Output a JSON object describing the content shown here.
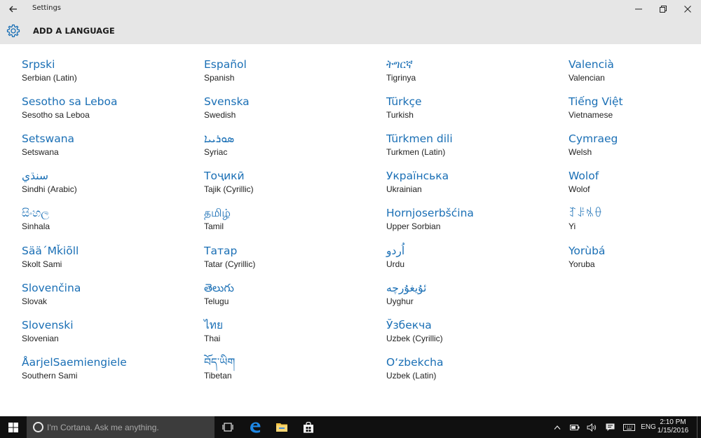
{
  "window": {
    "title": "Settings",
    "back_icon": "back-arrow-icon",
    "minimize_glyph": "—",
    "maximize_glyph": "❐",
    "close_glyph": "✕"
  },
  "header": {
    "icon": "gear-icon",
    "heading": "ADD A LANGUAGE"
  },
  "languages": [
    {
      "native": "Srpski",
      "english": "Serbian (Latin)"
    },
    {
      "native": "Sesotho sa Leboa",
      "english": "Sesotho sa Leboa"
    },
    {
      "native": "Setswana",
      "english": "Setswana"
    },
    {
      "native": "سنڌي",
      "english": "Sindhi (Arabic)"
    },
    {
      "native": "සිංහල",
      "english": "Sinhala"
    },
    {
      "native": "Sää´Mǩiõll",
      "english": "Skolt Sami"
    },
    {
      "native": "Slovenčina",
      "english": "Slovak"
    },
    {
      "native": "Slovenski",
      "english": "Slovenian"
    },
    {
      "native": "ÅarjelSaemiengiele",
      "english": "Southern Sami"
    },
    {
      "native": "Español",
      "english": "Spanish"
    },
    {
      "native": "Svenska",
      "english": "Swedish"
    },
    {
      "native": "ܣܘܪܝܝܐ",
      "english": "Syriac"
    },
    {
      "native": "Тоҷикӣ",
      "english": "Tajik (Cyrillic)"
    },
    {
      "native": "தமிழ்",
      "english": "Tamil"
    },
    {
      "native": "Татар",
      "english": "Tatar (Cyrillic)"
    },
    {
      "native": "తెలుగు",
      "english": "Telugu"
    },
    {
      "native": "ไทย",
      "english": "Thai"
    },
    {
      "native": "བོད་ཡིག",
      "english": "Tibetan"
    },
    {
      "native": "ትግርኛ",
      "english": "Tigrinya"
    },
    {
      "native": "Türkçe",
      "english": "Turkish"
    },
    {
      "native": "Türkmen dili",
      "english": "Turkmen (Latin)"
    },
    {
      "native": "Українська",
      "english": "Ukrainian"
    },
    {
      "native": "Hornjoserbšćina",
      "english": "Upper Sorbian"
    },
    {
      "native": "اُردو",
      "english": "Urdu"
    },
    {
      "native": "ئۇيغۇرچە",
      "english": "Uyghur"
    },
    {
      "native": "Ўзбекча",
      "english": "Uzbek (Cyrillic)"
    },
    {
      "native": "O‘zbekcha",
      "english": "Uzbek (Latin)"
    },
    {
      "native": "Valencià",
      "english": "Valencian"
    },
    {
      "native": "Tiếng Việt",
      "english": "Vietnamese"
    },
    {
      "native": "Cymraeg",
      "english": "Welsh"
    },
    {
      "native": "Wolof",
      "english": "Wolof"
    },
    {
      "native": "ꆈꌠꁱꂷ",
      "english": "Yi"
    },
    {
      "native": "Yorùbá",
      "english": "Yoruba"
    }
  ],
  "taskbar": {
    "search_placeholder": "I'm Cortana. Ask me anything.",
    "language_indicator": "ENG",
    "time": "2:10 PM",
    "date": "1/15/2016"
  },
  "colors": {
    "accent": "#1a6fb5",
    "header_bg": "#e6e6e6",
    "taskbar_bg": "#101010"
  }
}
